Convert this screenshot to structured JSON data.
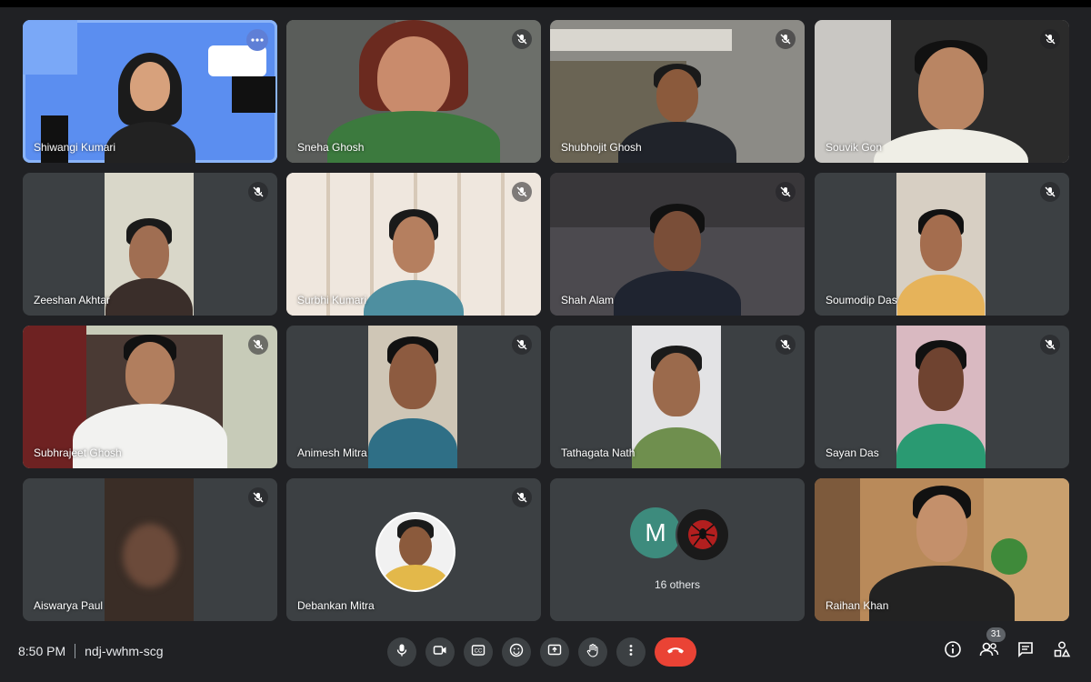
{
  "meeting": {
    "time": "8:50 PM",
    "code": "ndj-vwhm-scg"
  },
  "participants": [
    {
      "name": "Shiwangi Kumari"
    },
    {
      "name": "Sneha Ghosh"
    },
    {
      "name": "Shubhojit Ghosh"
    },
    {
      "name": "Souvik Gon"
    },
    {
      "name": "Zeeshan Akhtar"
    },
    {
      "name": "Surbhi Kumari"
    },
    {
      "name": "Shah Alam"
    },
    {
      "name": "Soumodip Das"
    },
    {
      "name": "Subhrajeet Ghosh"
    },
    {
      "name": "Animesh Mitra"
    },
    {
      "name": "Tathagata Nath"
    },
    {
      "name": "Sayan Das"
    },
    {
      "name": "Aiswarya Paul"
    },
    {
      "name": "Debankan Mitra"
    },
    {
      "name": "Raihan Khan"
    }
  ],
  "others_tile": {
    "avatar_letter": "M",
    "label": "16 others"
  },
  "people_count": "31",
  "icons": {
    "mic": "mic-icon",
    "camera": "camera-icon",
    "captions": "captions-icon",
    "emoji": "emoji-icon",
    "present": "present-screen-icon",
    "raise_hand": "raise-hand-icon",
    "more": "more-options-icon",
    "end_call": "end-call-icon",
    "info": "info-icon",
    "people": "people-icon",
    "chat": "chat-icon",
    "activities": "activities-icon"
  },
  "colors": {
    "background": "#202124",
    "tile": "#3c4043",
    "active_border": "#8ab4f8",
    "end_call": "#ea4335"
  }
}
